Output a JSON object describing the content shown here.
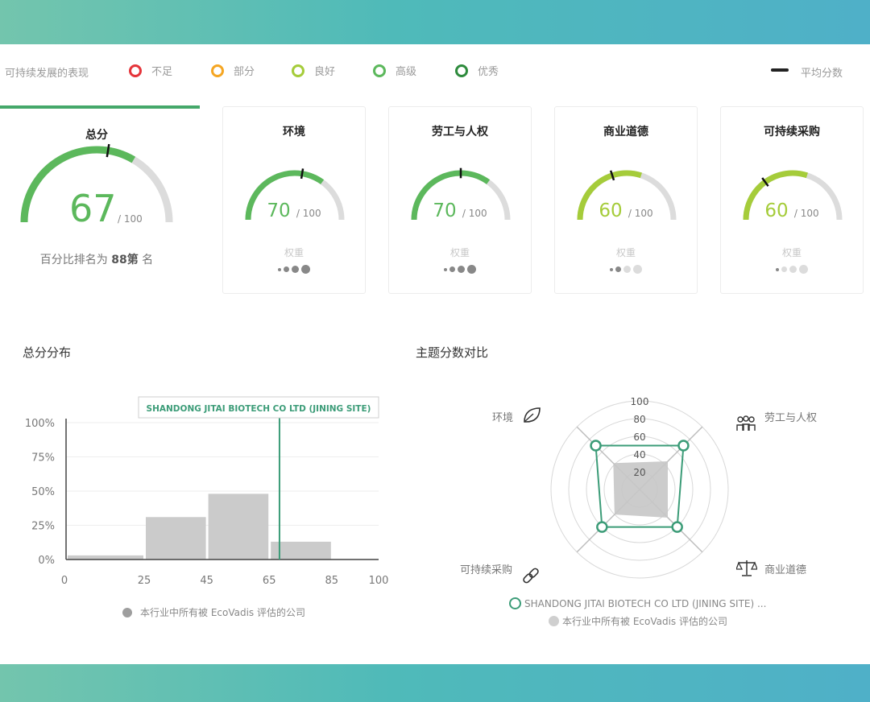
{
  "legend": {
    "label": "可持续发展的表现",
    "items": [
      {
        "label": "不足",
        "color": "#e5343a"
      },
      {
        "label": "部分",
        "color": "#f5a623"
      },
      {
        "label": "良好",
        "color": "#a5cc3a"
      },
      {
        "label": "高级",
        "color": "#5cb85c"
      },
      {
        "label": "优秀",
        "color": "#2e8b3d"
      }
    ],
    "average_label": "平均分数"
  },
  "overall": {
    "title": "总分",
    "score": 67,
    "out_of": "/ 100",
    "average": 55,
    "color": "#5cb85c",
    "rank_prefix": "百分比排名为 ",
    "rank_value": "88第",
    "rank_suffix": " 名"
  },
  "themes": [
    {
      "title": "环境",
      "score": 70,
      "out_of": "/ 100",
      "average": 55,
      "color": "#5cb85c",
      "weight_label": "权重",
      "weight_level": 4
    },
    {
      "title": "劳工与人权",
      "score": 70,
      "out_of": "/ 100",
      "average": 50,
      "color": "#5cb85c",
      "weight_label": "权重",
      "weight_level": 4
    },
    {
      "title": "商业道德",
      "score": 60,
      "out_of": "/ 100",
      "average": 40,
      "color": "#a5cc3a",
      "weight_label": "权重",
      "weight_level": 2
    },
    {
      "title": "可持续采购",
      "score": 60,
      "out_of": "/ 100",
      "average": 30,
      "color": "#a5cc3a",
      "weight_label": "权重",
      "weight_level": 1
    }
  ],
  "distribution": {
    "title": "总分分布",
    "company_label": "SHANDONG JITAI BIOTECH CO LTD (JINING SITE)",
    "legend": "本行业中所有被 EcoVadis 评估的公司",
    "chart_data": {
      "type": "bar",
      "x_ticks": [
        "0",
        "25",
        "45",
        "65",
        "85",
        "100"
      ],
      "y_ticks": [
        "0%",
        "25%",
        "50%",
        "75%",
        "100%"
      ],
      "bins": [
        {
          "from": 0,
          "to": 25,
          "value": 3
        },
        {
          "from": 25,
          "to": 45,
          "value": 31
        },
        {
          "from": 45,
          "to": 65,
          "value": 48
        },
        {
          "from": 65,
          "to": 85,
          "value": 13
        },
        {
          "from": 85,
          "to": 100,
          "value": 0
        }
      ],
      "company_score": 67,
      "ylim": [
        0,
        100
      ]
    }
  },
  "comparison": {
    "title": "主题分数对比",
    "legend_company": "SHANDONG JITAI BIOTECH CO LTD (JINING SITE) ...",
    "legend_industry": "本行业中所有被 EcoVadis 评估的公司",
    "chart_data": {
      "type": "radar",
      "axes": [
        "环境",
        "劳工与人权",
        "商业道德",
        "可持续采购"
      ],
      "ticks": [
        "20",
        "40",
        "60",
        "80",
        "100"
      ],
      "series": [
        {
          "name": "SHANDONG JITAI BIOTECH CO LTD (JINING SITE)",
          "values": [
            70,
            70,
            60,
            60
          ]
        },
        {
          "name": "本行业中所有被 EcoVadis 评估的公司",
          "values": [
            42,
            45,
            45,
            40
          ]
        }
      ],
      "rlim": [
        0,
        100
      ]
    }
  }
}
